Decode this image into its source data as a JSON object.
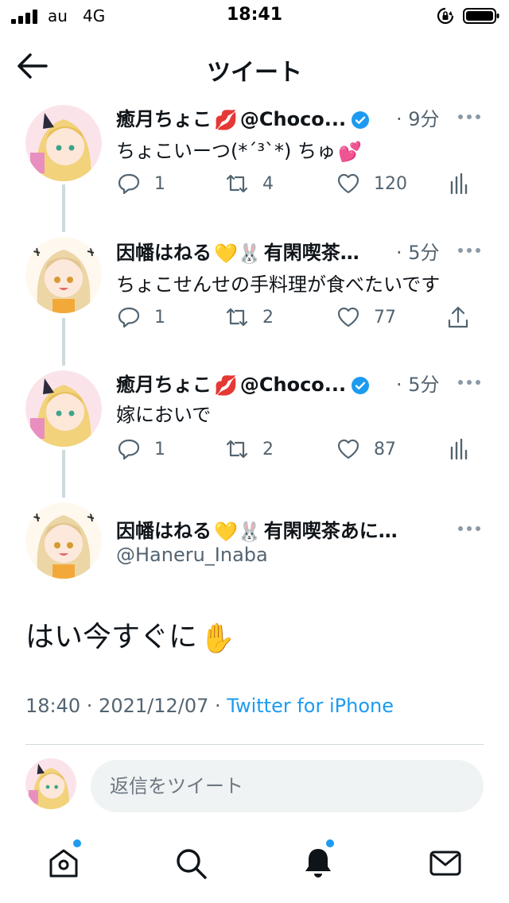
{
  "status_bar": {
    "carrier": "au",
    "network": "4G",
    "time": "18:41"
  },
  "header": {
    "title": "ツイート"
  },
  "tweets": [
    {
      "name": "癒月ちょこ",
      "name_emoji": "💋",
      "handle": "@Choco...",
      "verified": true,
      "time": "· 9分",
      "text": "ちょこいーつ(*´³`*) ちゅ",
      "text_emoji": "💕",
      "replies": "1",
      "retweets": "4",
      "likes": "120",
      "last_icon": "analytics-icon"
    },
    {
      "name": "因幡はねる",
      "name_emoji": "💛🐰",
      "handle": "有閑喫茶…",
      "verified": false,
      "time": "· 5分",
      "text": "ちょこせんせの手料理が食べたいです",
      "text_emoji": "",
      "replies": "1",
      "retweets": "2",
      "likes": "77",
      "last_icon": "share-icon"
    },
    {
      "name": "癒月ちょこ",
      "name_emoji": "💋",
      "handle": "@Choco...",
      "verified": true,
      "time": "· 5分",
      "text": "嫁においで",
      "text_emoji": "",
      "replies": "1",
      "retweets": "2",
      "likes": "87",
      "last_icon": "analytics-icon"
    }
  ],
  "focused_tweet": {
    "name": "因幡はねる",
    "name_emoji": "💛🐰",
    "name_suffix": "有閑喫茶あに…",
    "handle": "@Haneru_Inaba",
    "text": "はい今すぐに",
    "text_emoji": "✋",
    "timestamp": "18:40 · 2021/12/07 · ",
    "source": "Twitter for iPhone"
  },
  "reply": {
    "placeholder": "返信をツイート"
  },
  "tab_bar": [
    "home-icon",
    "search-icon",
    "notifications-icon",
    "messages-icon"
  ],
  "colors": {
    "accent": "#1d9bf0",
    "text": "#0f1419",
    "secondary": "#536471",
    "line": "#cfd9de"
  }
}
